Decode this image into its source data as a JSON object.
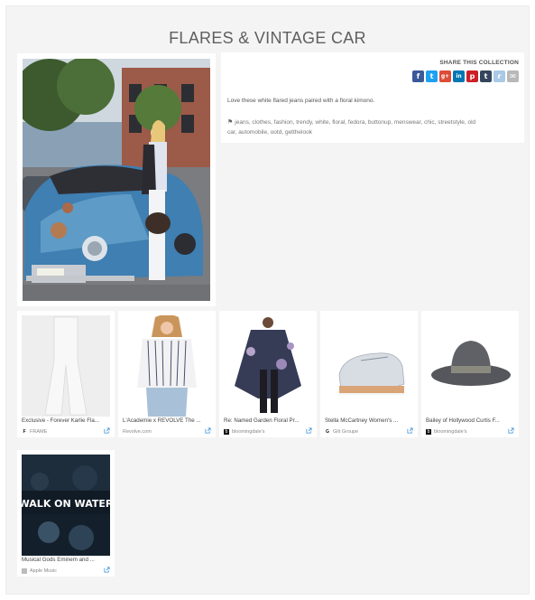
{
  "page": {
    "title": "FLARES & VINTAGE CAR"
  },
  "share": {
    "label": "SHARE THIS COLLECTION",
    "icons": [
      {
        "name": "facebook",
        "glyph": "f",
        "color": "#3b5998"
      },
      {
        "name": "twitter",
        "glyph": "t",
        "color": "#1da1f2"
      },
      {
        "name": "google-plus",
        "glyph": "g+",
        "color": "#dd4b39"
      },
      {
        "name": "linkedin",
        "glyph": "in",
        "color": "#0077b5"
      },
      {
        "name": "pinterest",
        "glyph": "p",
        "color": "#cb2027"
      },
      {
        "name": "tumblr",
        "glyph": "t",
        "color": "#35465c"
      },
      {
        "name": "reddit",
        "glyph": "r",
        "color": "#a9c9e6"
      },
      {
        "name": "email",
        "glyph": "✉",
        "color": "#b8b8b8"
      }
    ]
  },
  "collection": {
    "description": "Love these white flared jeans paired with a floral kimono.",
    "tags_line1": "jeans, clothes, fashion, trendy, white, floral, fedora, buttonup, menswear, chic, streetstyle, old",
    "tags_line2": "car, automobile, ootd, getthelook"
  },
  "products": [
    {
      "title": "Exclusive - Forever Karlie Fla...",
      "source": "FRAME",
      "logo": "F"
    },
    {
      "title": "L'Academie x REVOLVE The ...",
      "source": "Revolve.com",
      "logo": ""
    },
    {
      "title": "Re: Named Garden Floral Pr...",
      "source": "bloomingdale's",
      "logo": "b"
    },
    {
      "title": "Stella McCartney Women's ...",
      "source": "Gilt Groupe",
      "logo": "G"
    },
    {
      "title": "Bailey of Hollywood Curtis F...",
      "source": "bloomingdale's",
      "logo": "b"
    },
    {
      "title": "Musical Gods Eminem and ...",
      "source": "Apple Music",
      "logo": ""
    }
  ],
  "album_art_text": "WALK ON WATER"
}
